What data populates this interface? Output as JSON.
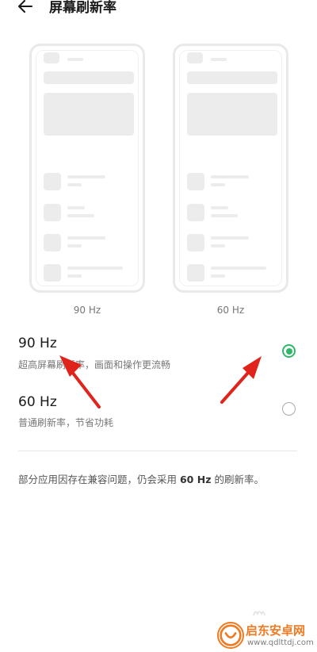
{
  "header": {
    "title": "屏幕刷新率"
  },
  "previews": [
    {
      "label": "90 Hz"
    },
    {
      "label": "60 Hz"
    }
  ],
  "options": [
    {
      "title": "90 Hz",
      "subtitle": "超高屏幕刷新率，画面和操作更流畅",
      "selected": true
    },
    {
      "title": "60 Hz",
      "subtitle": "普通刷新率，节省功耗",
      "selected": false
    }
  ],
  "note": {
    "prefix": "部分应用因存在兼容问题，仍会采用 ",
    "bold": "60 Hz",
    "suffix": " 的刷新率。"
  },
  "watermark": {
    "name": "启东安卓网",
    "url": "www.qdlttdj.com"
  },
  "colors": {
    "accent": "#2fb86a",
    "annotation": "#e0241b",
    "watermark": "#f07a22"
  }
}
